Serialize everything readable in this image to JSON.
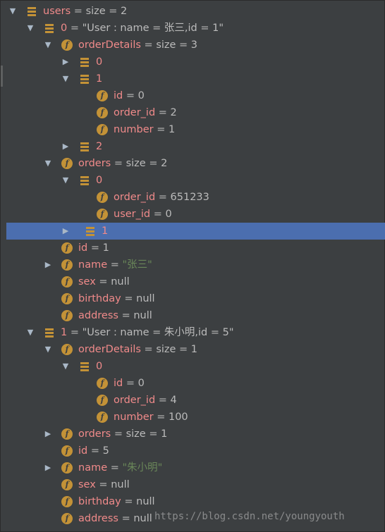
{
  "tree": [
    {
      "depth": 0,
      "arrow": "down",
      "icon": "array",
      "name": "users",
      "sep": " = ",
      "value": " size = 2"
    },
    {
      "depth": 1,
      "arrow": "down",
      "icon": "array",
      "name": "0",
      "sep": " = ",
      "value": "\"User : name = 张三,id = 1\""
    },
    {
      "depth": 2,
      "arrow": "down",
      "icon": "field",
      "name": "orderDetails",
      "sep": " = ",
      "value": " size = 3"
    },
    {
      "depth": 3,
      "arrow": "right",
      "icon": "array",
      "name": "0",
      "sep": "",
      "value": ""
    },
    {
      "depth": 3,
      "arrow": "down",
      "icon": "array",
      "name": "1",
      "sep": "",
      "value": ""
    },
    {
      "depth": 4,
      "arrow": "",
      "icon": "field",
      "name": "id",
      "sep": " = ",
      "value": "0"
    },
    {
      "depth": 4,
      "arrow": "",
      "icon": "field",
      "name": "order_id",
      "sep": " = ",
      "value": "2"
    },
    {
      "depth": 4,
      "arrow": "",
      "icon": "field",
      "name": "number",
      "sep": " = ",
      "value": "1"
    },
    {
      "depth": 3,
      "arrow": "right",
      "icon": "array",
      "name": "2",
      "sep": "",
      "value": ""
    },
    {
      "depth": 2,
      "arrow": "down",
      "icon": "field",
      "name": "orders",
      "sep": " = ",
      "value": " size = 2"
    },
    {
      "depth": 3,
      "arrow": "down",
      "icon": "array",
      "name": "0",
      "sep": "",
      "value": ""
    },
    {
      "depth": 4,
      "arrow": "",
      "icon": "field",
      "name": "order_id",
      "sep": " = ",
      "value": "651233"
    },
    {
      "depth": 4,
      "arrow": "",
      "icon": "field",
      "name": "user_id",
      "sep": " = ",
      "value": "0"
    },
    {
      "depth": 3,
      "arrow": "right",
      "icon": "array",
      "name": "1",
      "sep": "",
      "value": "",
      "selected": true
    },
    {
      "depth": 2,
      "arrow": "",
      "icon": "field",
      "name": "id",
      "sep": " = ",
      "value": "1"
    },
    {
      "depth": 2,
      "arrow": "right",
      "icon": "field",
      "name": "name",
      "sep": " = ",
      "value": "\"张三\"",
      "string": true
    },
    {
      "depth": 2,
      "arrow": "",
      "icon": "field",
      "name": "sex",
      "sep": " = ",
      "value": "null"
    },
    {
      "depth": 2,
      "arrow": "",
      "icon": "field",
      "name": "birthday",
      "sep": " = ",
      "value": "null"
    },
    {
      "depth": 2,
      "arrow": "",
      "icon": "field",
      "name": "address",
      "sep": " = ",
      "value": "null"
    },
    {
      "depth": 1,
      "arrow": "down",
      "icon": "array",
      "name": "1",
      "sep": " = ",
      "value": "\"User : name = 朱小明,id = 5\""
    },
    {
      "depth": 2,
      "arrow": "down",
      "icon": "field",
      "name": "orderDetails",
      "sep": " = ",
      "value": " size = 1"
    },
    {
      "depth": 3,
      "arrow": "down",
      "icon": "array",
      "name": "0",
      "sep": "",
      "value": ""
    },
    {
      "depth": 4,
      "arrow": "",
      "icon": "field",
      "name": "id",
      "sep": " = ",
      "value": "0"
    },
    {
      "depth": 4,
      "arrow": "",
      "icon": "field",
      "name": "order_id",
      "sep": " = ",
      "value": "4"
    },
    {
      "depth": 4,
      "arrow": "",
      "icon": "field",
      "name": "number",
      "sep": " = ",
      "value": "100"
    },
    {
      "depth": 2,
      "arrow": "right",
      "icon": "field",
      "name": "orders",
      "sep": " = ",
      "value": " size = 1"
    },
    {
      "depth": 2,
      "arrow": "",
      "icon": "field",
      "name": "id",
      "sep": " = ",
      "value": "5"
    },
    {
      "depth": 2,
      "arrow": "right",
      "icon": "field",
      "name": "name",
      "sep": " = ",
      "value": "\"朱小明\"",
      "string": true
    },
    {
      "depth": 2,
      "arrow": "",
      "icon": "field",
      "name": "sex",
      "sep": " = ",
      "value": "null"
    },
    {
      "depth": 2,
      "arrow": "",
      "icon": "field",
      "name": "birthday",
      "sep": " = ",
      "value": "null"
    },
    {
      "depth": 2,
      "arrow": "",
      "icon": "field",
      "name": "address",
      "sep": " = ",
      "value": "null"
    }
  ],
  "field_icon_glyph": "f",
  "watermark": "https://blog.csdn.net/youngyouth",
  "colors": {
    "background": "#3c3f41",
    "selection": "#4b6eaf",
    "name": "#f08a8a",
    "string": "#6a8759",
    "field_icon": "#c39237"
  }
}
